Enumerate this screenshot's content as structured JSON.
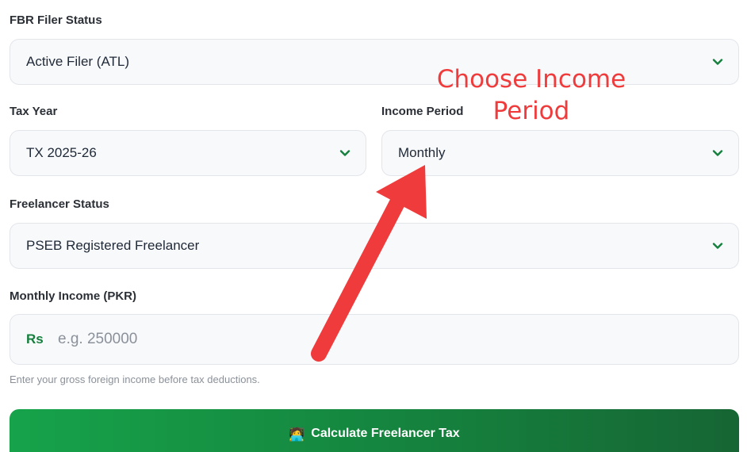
{
  "filer_status": {
    "label": "FBR Filer Status",
    "value": "Active Filer (ATL)"
  },
  "tax_year": {
    "label": "Tax Year",
    "value": "TX 2025-26"
  },
  "income_period": {
    "label": "Income Period",
    "value": "Monthly"
  },
  "freelancer_status": {
    "label": "Freelancer Status",
    "value": "PSEB Registered Freelancer"
  },
  "monthly_income": {
    "label": "Monthly Income (PKR)",
    "prefix": "Rs",
    "placeholder": "e.g. 250000",
    "hint": "Enter your gross foreign income before tax deductions."
  },
  "calculate_button": {
    "emoji": "🧑‍💻",
    "label": "Calculate Freelancer Tax"
  },
  "annotation": {
    "line1": "Choose Income",
    "line2": "Period"
  },
  "colors": {
    "accent": "#16a34a",
    "annotation": "#ef3b3b",
    "chevron": "#15803d"
  }
}
